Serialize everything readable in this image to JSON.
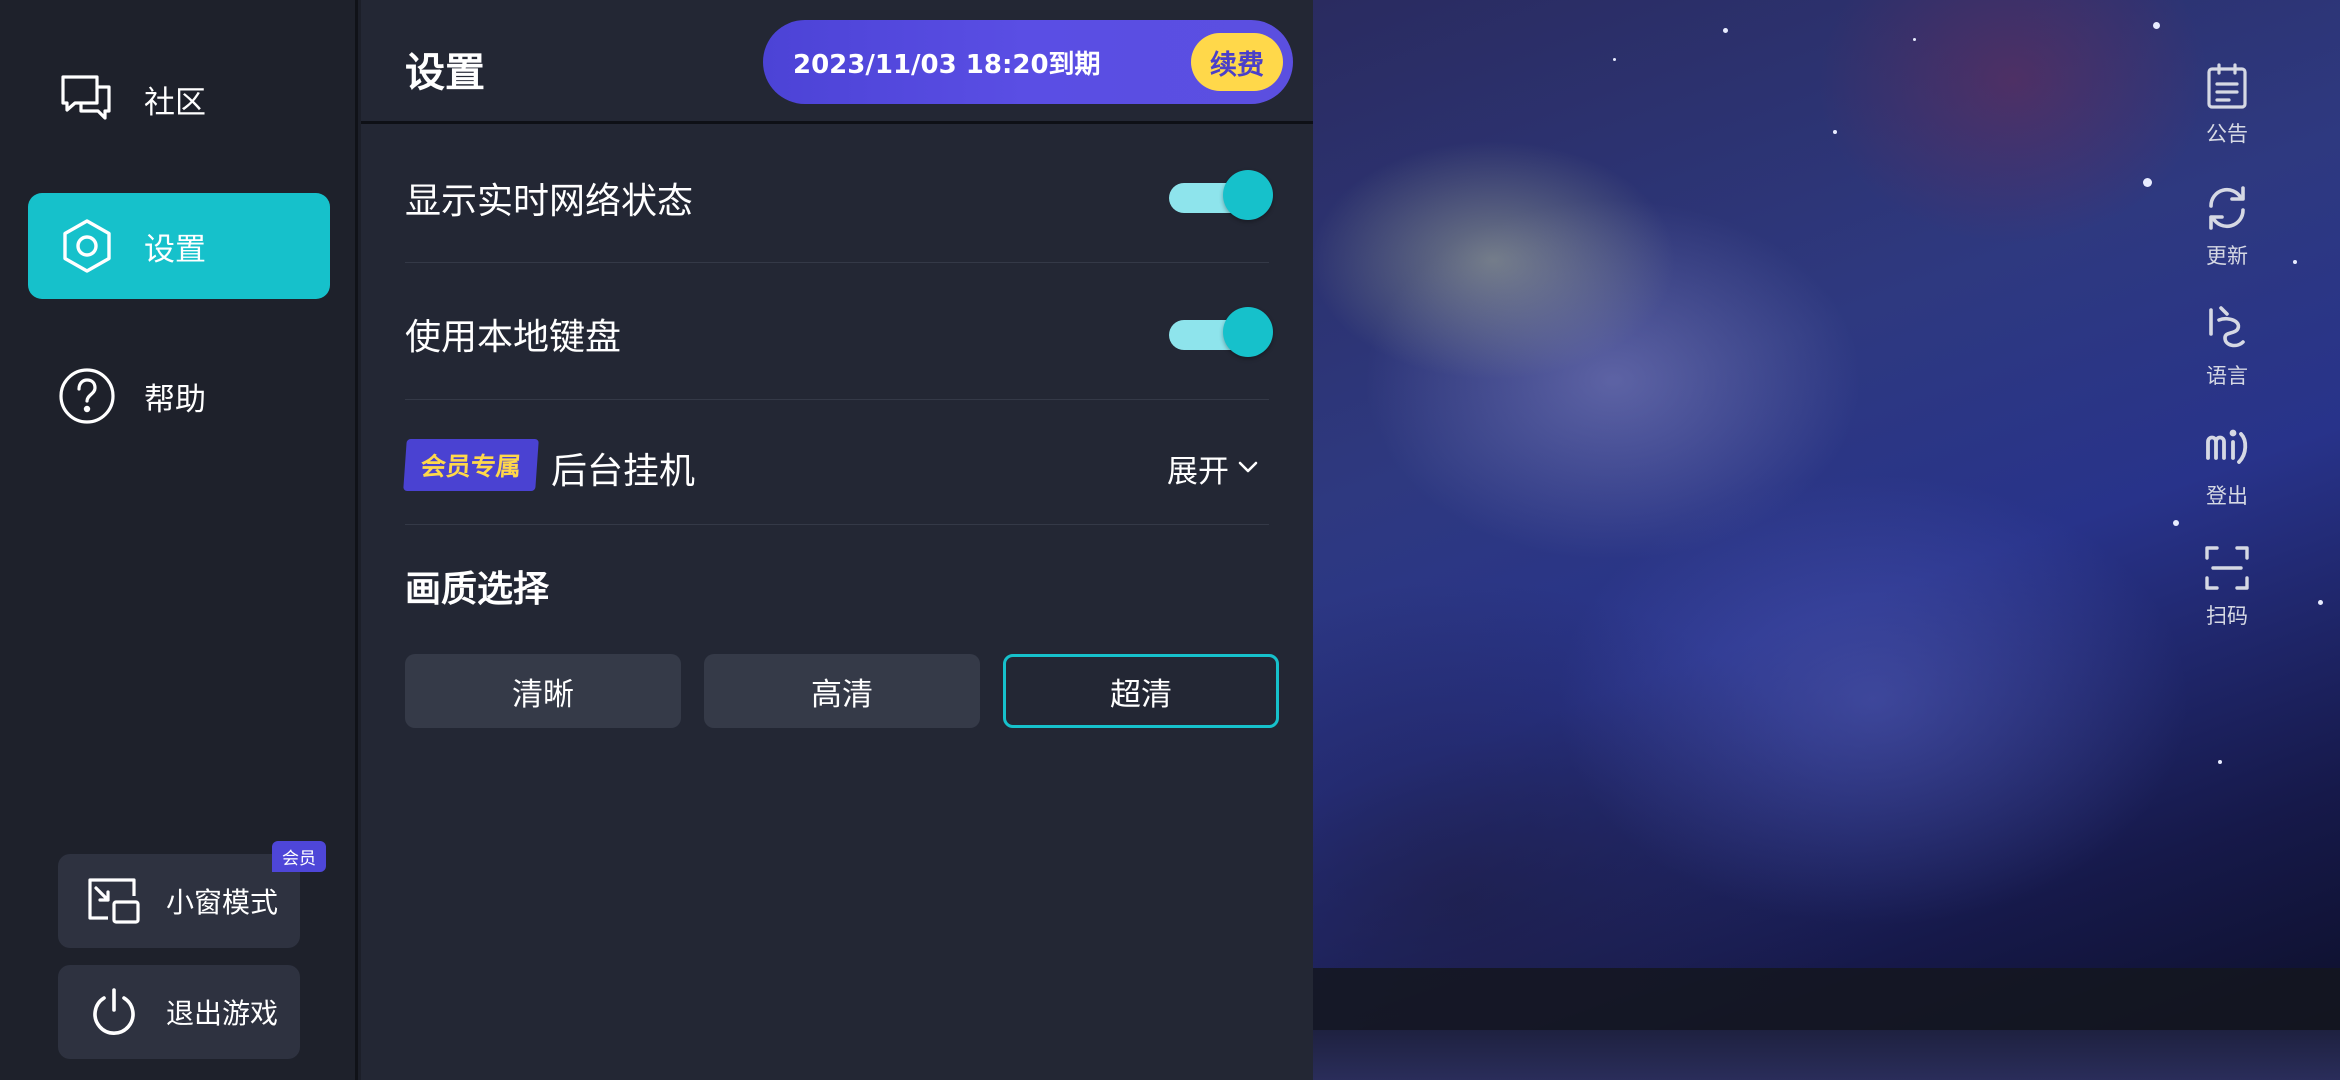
{
  "sidebar": {
    "items": [
      {
        "label": "社区",
        "icon": "chat-bubbles-icon"
      },
      {
        "label": "设置",
        "icon": "hexagon-settings-icon",
        "active": true
      },
      {
        "label": "帮助",
        "icon": "question-circle-icon"
      }
    ],
    "bottom_buttons": [
      {
        "label": "小窗模式",
        "icon": "picture-in-picture-icon",
        "tag": "会员"
      },
      {
        "label": "退出游戏",
        "icon": "power-icon"
      }
    ]
  },
  "panel": {
    "title": "设置",
    "expire_text": "2023/11/03 18:20到期",
    "renew_label": "续费",
    "rows": [
      {
        "label": "显示实时网络状态",
        "toggle_on": true
      },
      {
        "label": "使用本地键盘",
        "toggle_on": true
      },
      {
        "label": "后台挂机",
        "badge": "会员专属",
        "expand_label": "展开"
      }
    ],
    "quality": {
      "title": "画质选择",
      "options": [
        "清晰",
        "高清",
        "超清"
      ],
      "selected": "超清"
    }
  },
  "tools": [
    {
      "label": "公告",
      "icon": "clipboard-icon"
    },
    {
      "label": "更新",
      "icon": "refresh-icon"
    },
    {
      "label": "语言",
      "icon": "language-icon"
    },
    {
      "label": "登出",
      "icon": "logout-icon"
    },
    {
      "label": "扫码",
      "icon": "scan-icon"
    }
  ],
  "colors": {
    "accent": "#16c1cb",
    "vip_purple": "#4c43d6",
    "vip_yellow": "#ffd84a",
    "panel_bg": "#232734",
    "nav_bg": "#1e212b"
  }
}
